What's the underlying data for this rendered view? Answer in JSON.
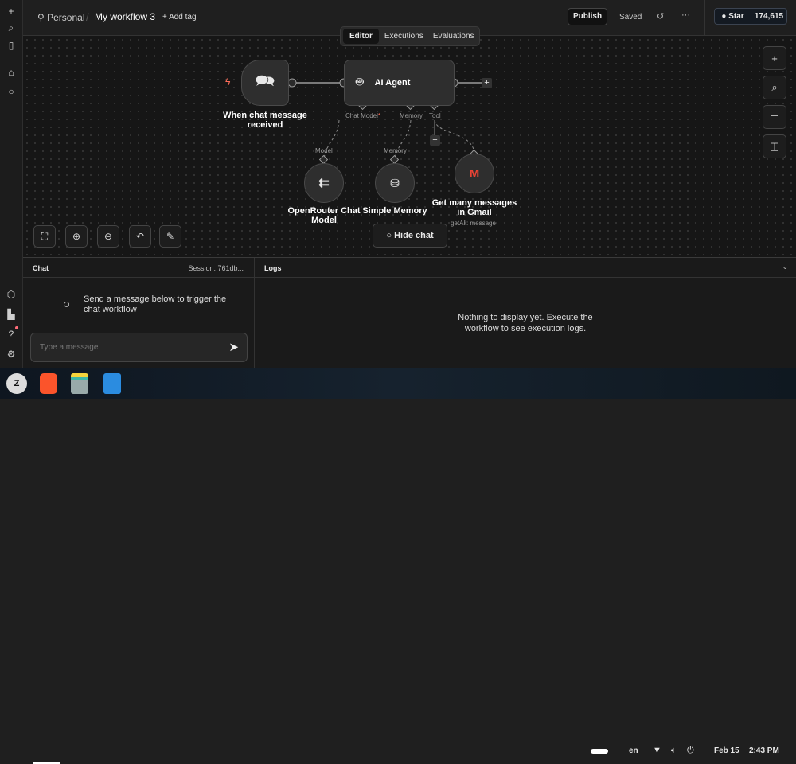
{
  "header": {
    "project": "Personal",
    "workflow": "My workflow 3",
    "add_tag": "+ Add tag",
    "publish": "Publish",
    "saved": "Saved",
    "star": "Star",
    "star_count": "174,615"
  },
  "tabs": [
    {
      "label": "Editor",
      "active": true
    },
    {
      "label": "Executions"
    },
    {
      "label": "Evaluations"
    }
  ],
  "nodes": {
    "trigger": "When chat message received",
    "agent": "AI Agent",
    "openrouter": "OpenRouter Chat Model",
    "memory": "Simple Memory",
    "gmail": "Get many messages in Gmail",
    "gmail_sub": "getAll: message"
  },
  "ports": {
    "chat_model": "Chat Model",
    "required": "*",
    "memory": "Memory",
    "tool": "Tool",
    "model_in": "Model",
    "memory_in": "Memory"
  },
  "canvas": {
    "hide_chat": "Hide chat"
  },
  "chat": {
    "title": "Chat",
    "session": "Session: 761db...",
    "hint": "Send a message below to trigger the chat workflow",
    "placeholder": "Type a message"
  },
  "logs": {
    "title": "Logs",
    "empty": "Nothing to display yet. Execute the workflow to see execution logs."
  },
  "taskbar": {
    "lang": "en",
    "date": "Feb 15",
    "time": "2:43 PM"
  },
  "colors": {
    "accent": "#ff6d5a",
    "bg": "#161616"
  }
}
